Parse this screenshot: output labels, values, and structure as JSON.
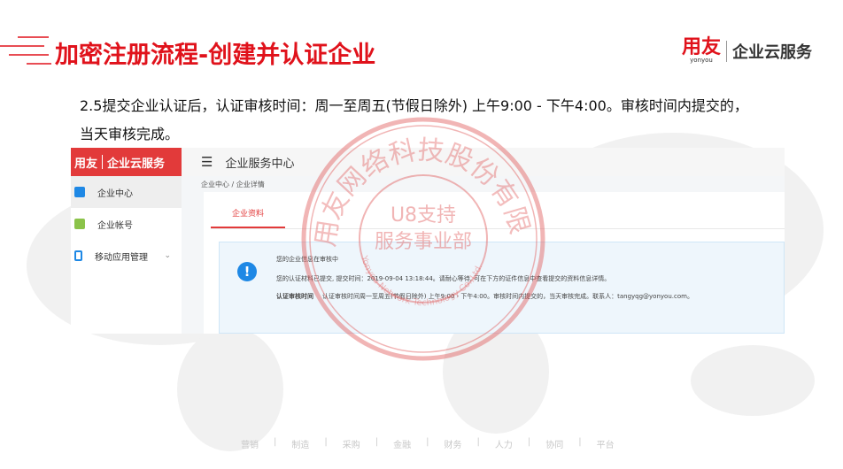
{
  "header": {
    "title": "加密注册流程-创建并认证企业",
    "logo_mark": "用友",
    "logo_sub": "yonyou",
    "logo_text": "企业云服务"
  },
  "description": "2.5提交企业认证后，认证审核时间：周一至周五(节假日除外) 上午9:00 - 下午4:00。审核时间内提交的，当天审核完成。",
  "screenshot": {
    "logo_mark": "用友",
    "logo_text": "企业云服务",
    "nav": [
      {
        "label": "企业中心",
        "icon": "building-icon"
      },
      {
        "label": "企业帐号",
        "icon": "account-icon"
      },
      {
        "label": "移动应用管理",
        "icon": "mobile-icon",
        "chevron": "⌄"
      }
    ],
    "topbar_title": "企业服务中心",
    "menu_icon": "☰",
    "breadcrumb": [
      "企业中心",
      "企业详情"
    ],
    "breadcrumb_sep": "/",
    "tab": "企业资料",
    "info": {
      "icon": "!",
      "line1": "您的企业信息在审核中",
      "line2": "您的认证材料已提交, 提交时间：2019-09-04 13:18:44。请耐心等待, 可在下方的证件信息中查看提交的资料信息详情。",
      "label": "认证审核时间",
      "line3": "认证审核时间周一至周五(节假日除外) 上午9:00 - 下午4:00。审核时间内提交的，当天审核完成。联系人：tangyqg@yonyou.com。"
    }
  },
  "stamp": {
    "outer": "用友网络科技股份有限公司",
    "inner1": "U8支持",
    "inner2": "服务事业部",
    "english": "Yonyou Network Technology Co.,Ltd."
  },
  "footer": [
    "营销",
    "制造",
    "采购",
    "金融",
    "财务",
    "人力",
    "协同",
    "平台"
  ],
  "colors": {
    "brand": "#e0121b",
    "info": "#1e88e5"
  }
}
